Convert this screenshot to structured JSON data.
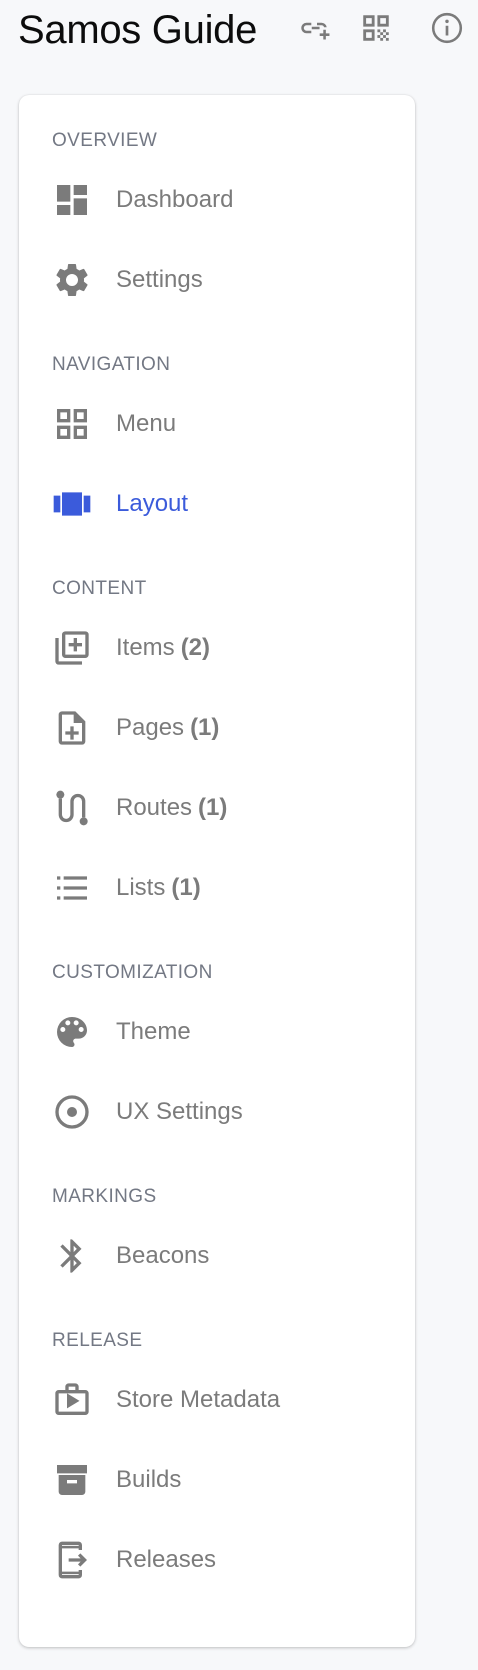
{
  "app": {
    "title": "Samos Guide"
  },
  "header_actions": [
    {
      "icon": "link-add-icon"
    },
    {
      "icon": "qr-code-icon"
    },
    {
      "icon": "info-icon"
    }
  ],
  "colors": {
    "active": "#3b5bdb",
    "icon": "#7b7b7b",
    "section": "#737884"
  },
  "sidebar": {
    "sections": [
      {
        "label": "OVERVIEW",
        "items": [
          {
            "label": "Dashboard",
            "icon": "dashboard-icon"
          },
          {
            "label": "Settings",
            "icon": "gear-icon"
          }
        ]
      },
      {
        "label": "NAVIGATION",
        "items": [
          {
            "label": "Menu",
            "icon": "grid-icon"
          },
          {
            "label": "Layout",
            "icon": "layout-icon",
            "active": true
          }
        ]
      },
      {
        "label": "CONTENT",
        "items": [
          {
            "label": "Items",
            "count": "(2)",
            "icon": "library-add-icon"
          },
          {
            "label": "Pages",
            "count": "(1)",
            "icon": "note-add-icon"
          },
          {
            "label": "Routes",
            "count": "(1)",
            "icon": "route-icon"
          },
          {
            "label": "Lists",
            "count": "(1)",
            "icon": "list-icon"
          }
        ]
      },
      {
        "label": "CUSTOMIZATION",
        "items": [
          {
            "label": "Theme",
            "icon": "palette-icon"
          },
          {
            "label": "UX Settings",
            "icon": "radio-button-icon"
          }
        ]
      },
      {
        "label": "MARKINGS",
        "items": [
          {
            "label": "Beacons",
            "icon": "bluetooth-icon"
          }
        ]
      },
      {
        "label": "RELEASE",
        "items": [
          {
            "label": "Store Metadata",
            "icon": "store-play-icon"
          },
          {
            "label": "Builds",
            "icon": "archive-icon"
          },
          {
            "label": "Releases",
            "icon": "phone-export-icon"
          }
        ]
      }
    ]
  }
}
